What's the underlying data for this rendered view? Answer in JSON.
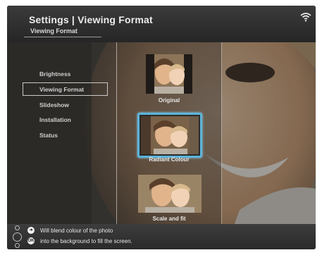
{
  "header": {
    "title": "Settings | Viewing Format",
    "subtitle": "Viewing Format",
    "status_icon": "wifi-icon"
  },
  "menu": {
    "items": [
      {
        "label": "Brightness",
        "selected": false
      },
      {
        "label": "Viewing Format",
        "selected": true
      },
      {
        "label": "Slideshow",
        "selected": false
      },
      {
        "label": "Installation",
        "selected": false
      },
      {
        "label": "Status",
        "selected": false
      }
    ]
  },
  "options": [
    {
      "label": "Original",
      "selected": false
    },
    {
      "label": "Radiant Colour",
      "selected": true
    },
    {
      "label": "Scale and fit",
      "selected": false
    }
  ],
  "footer": {
    "hint_line1": "Will blend colour of the photo",
    "hint_line2": "into the background to fill the screen.",
    "icons": [
      "navigate-icon",
      "ok-icon"
    ]
  },
  "colors": {
    "selection_border": "#5db4d9",
    "header_bg": "#333333",
    "text": "#e8e8e8"
  }
}
